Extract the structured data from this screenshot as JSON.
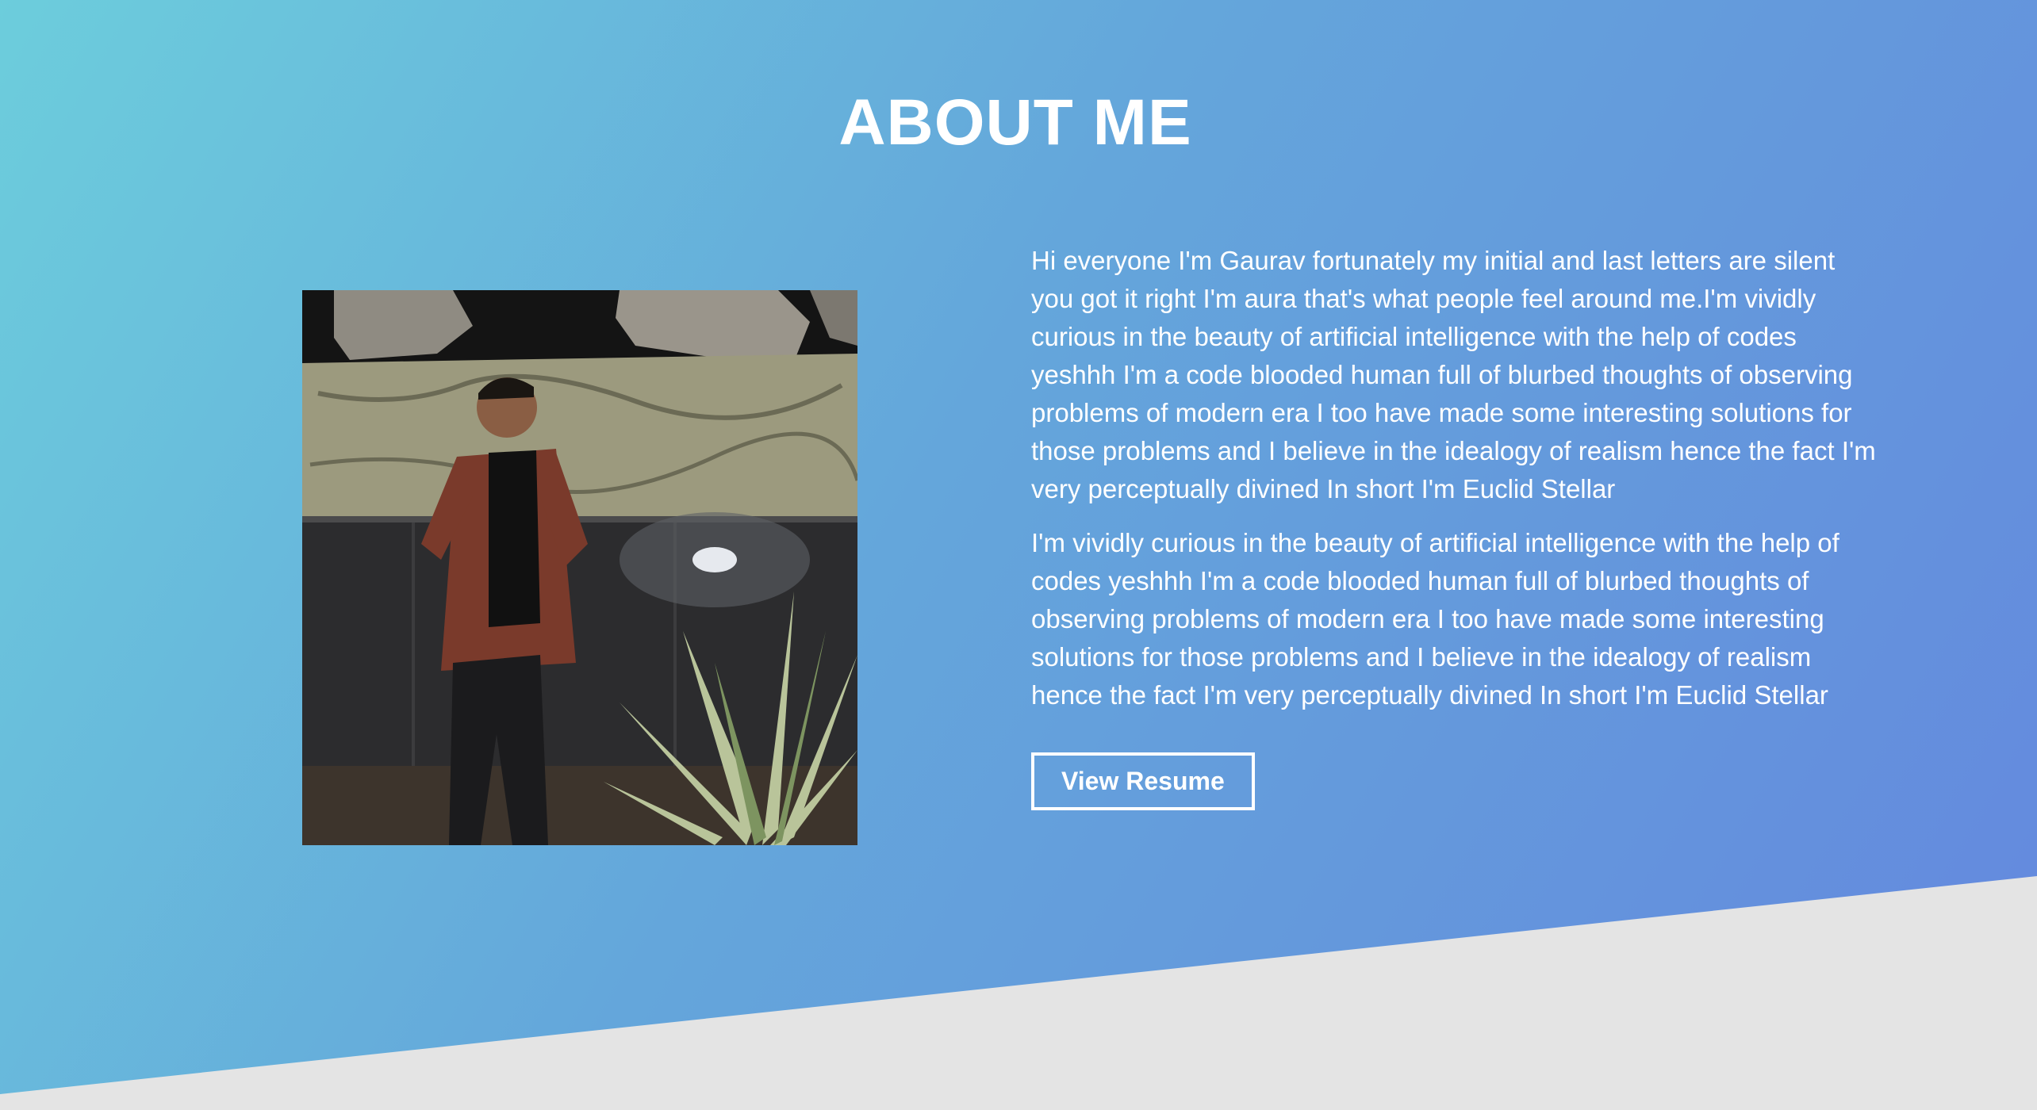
{
  "about": {
    "title": "ABOUT ME",
    "paragraphs": [
      "Hi everyone I'm Gaurav fortunately my initial and last letters are silent you got it right I'm aura that's what people feel around me.I'm vividly curious in the beauty of artificial intelligence with the help of codes yeshhh I'm a code blooded human full of blurbed thoughts of observing problems of modern era I too have made some interesting solutions for those problems and I believe in the idealogy of realism hence the fact I'm very perceptually divined In short I'm Euclid Stellar",
      "I'm vividly curious in the beauty of artificial intelligence with the help of codes yeshhh I'm a code blooded human full of blurbed thoughts of observing problems of modern era I too have made some interesting solutions for those problems and I believe in the idealogy of realism hence the fact I'm very perceptually divined In short I'm Euclid Stellar"
    ],
    "resume_button": "View Resume"
  },
  "colors": {
    "gradient_start": "#6ccddc",
    "gradient_end": "#6488de",
    "wedge": "#e4e4e4",
    "text": "#ffffff"
  }
}
